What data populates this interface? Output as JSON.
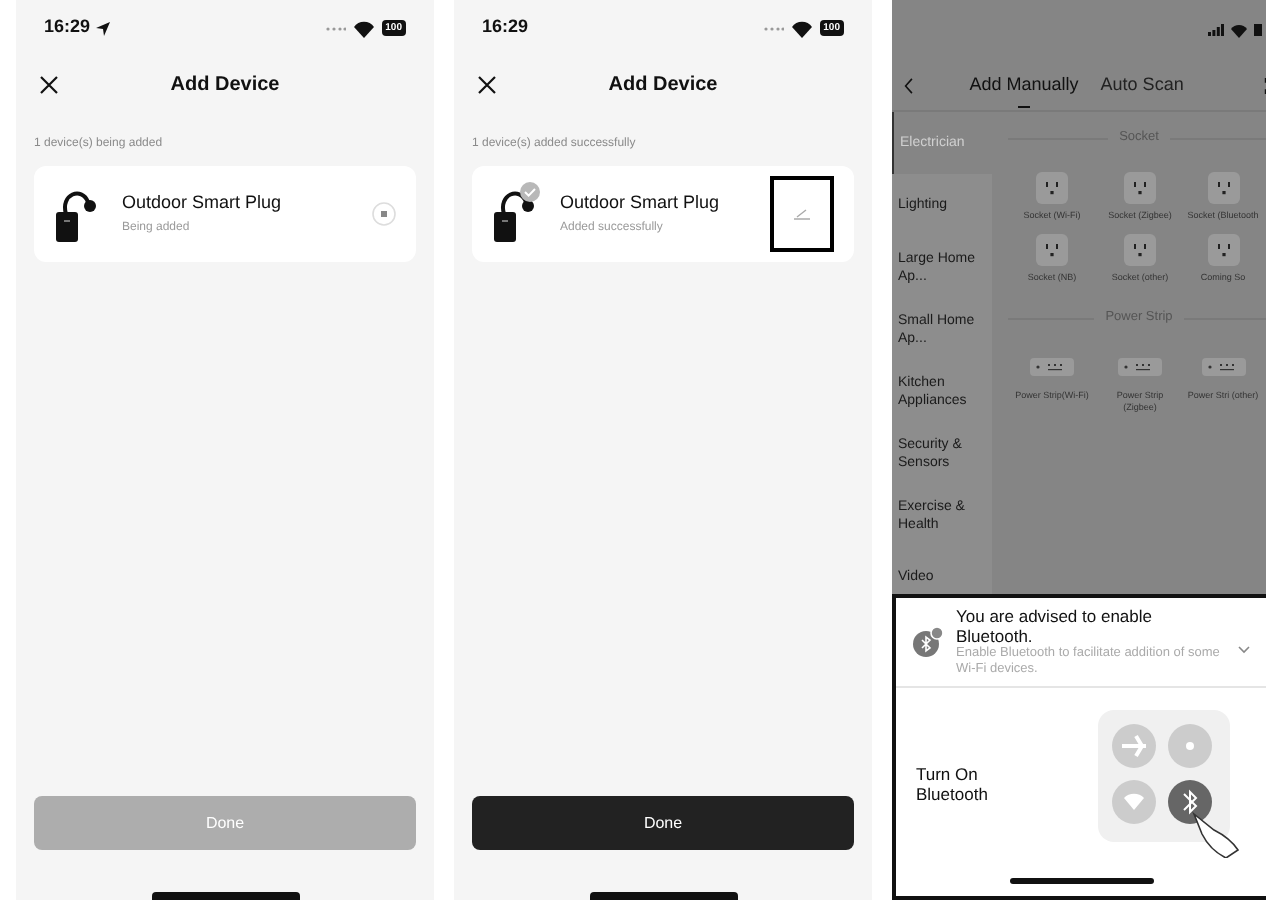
{
  "screens": [
    {
      "kind": "device",
      "status_bar": {
        "time": "16:29",
        "location": true,
        "battery": "100"
      },
      "title": "Add Device",
      "subtitle": "1 device(s) being added",
      "device": {
        "name": "Outdoor Smart Plug",
        "status": "Being added",
        "added": false
      },
      "done_button": {
        "label": "Done",
        "disabled": true
      }
    },
    {
      "kind": "device",
      "status_bar": {
        "time": "16:29",
        "location": false,
        "battery": "100"
      },
      "title": "Add Device",
      "subtitle": "1 device(s) added successfully",
      "device": {
        "name": "Outdoor Smart Plug",
        "status": "Added successfully",
        "added": true,
        "edit_highlighted": true
      },
      "done_button": {
        "label": "Done",
        "disabled": false
      }
    },
    {
      "kind": "catalog",
      "tabs": [
        {
          "label": "Add Manually",
          "selected": true
        },
        {
          "label": "Auto Scan",
          "selected": false
        }
      ],
      "categories": [
        {
          "label": "Electrician",
          "selected": true
        },
        {
          "label": "Lighting",
          "selected": false
        },
        {
          "label": "Large Home Ap...",
          "selected": false
        },
        {
          "label": "Small Home Ap...",
          "selected": false
        },
        {
          "label": "Kitchen Appliances",
          "selected": false
        },
        {
          "label": "Security & Sensors",
          "selected": false
        },
        {
          "label": "Exercise & Health",
          "selected": false
        },
        {
          "label": "Video",
          "selected": false
        }
      ],
      "sections": [
        {
          "kind": "socket",
          "title": "Socket",
          "items": [
            {
              "label": "Socket (Wi-Fi)"
            },
            {
              "label": "Socket (Zigbee)"
            },
            {
              "label": "Socket (Bluetooth"
            },
            {
              "label": "Socket (NB)"
            },
            {
              "label": "Socket (other)"
            },
            {
              "label": "Coming So"
            }
          ]
        },
        {
          "kind": "strip",
          "title": "Power Strip",
          "items": [
            {
              "label": "Power Strip(Wi-Fi)"
            },
            {
              "label": "Power Strip (Zigbee)"
            },
            {
              "label": "Power Stri (other)"
            }
          ]
        }
      ],
      "bluetooth_prompt": {
        "title": "You are advised to enable Bluetooth.",
        "message": "Enable Bluetooth to facilitate addition of some Wi-Fi devices.",
        "instruction": "Turn On Bluetooth"
      }
    }
  ]
}
